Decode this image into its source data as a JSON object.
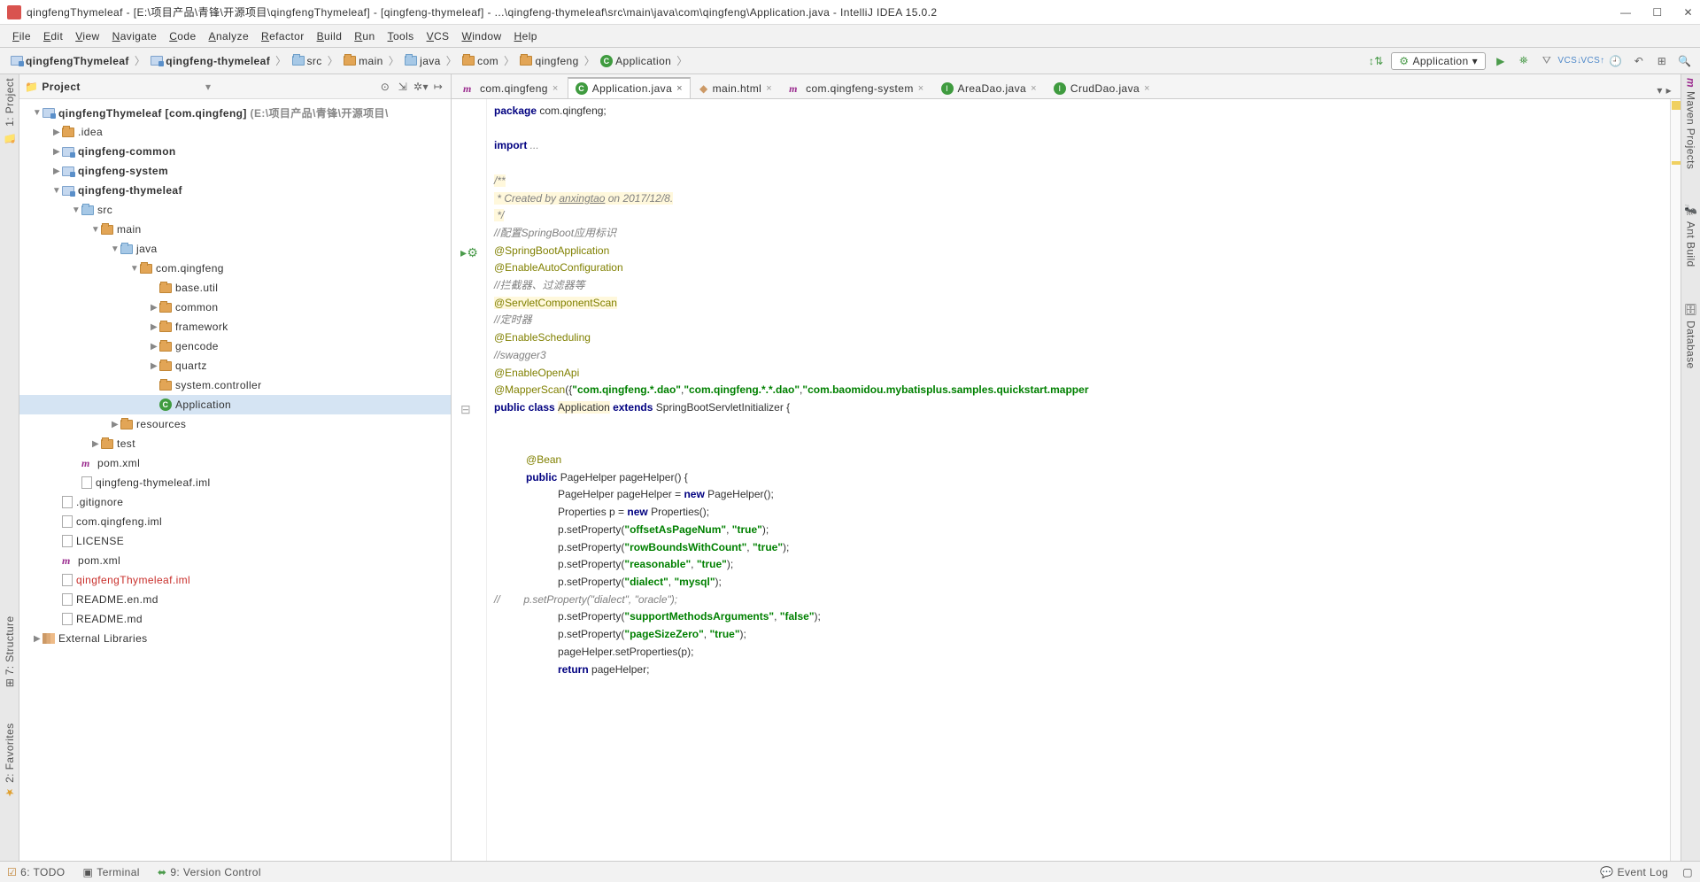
{
  "title": "qingfengThymeleaf - [E:\\项目产品\\青锋\\开源项目\\qingfengThymeleaf] - [qingfeng-thymeleaf] - ...\\qingfeng-thymeleaf\\src\\main\\java\\com\\qingfeng\\Application.java - IntelliJ IDEA 15.0.2",
  "menu": [
    "File",
    "Edit",
    "View",
    "Navigate",
    "Code",
    "Analyze",
    "Refactor",
    "Build",
    "Run",
    "Tools",
    "VCS",
    "Window",
    "Help"
  ],
  "breadcrumbs": [
    {
      "icon": "module",
      "label": "qingfengThymeleaf",
      "bold": true
    },
    {
      "icon": "module",
      "label": "qingfeng-thymeleaf",
      "bold": true
    },
    {
      "icon": "folder-blue",
      "label": "src"
    },
    {
      "icon": "folder",
      "label": "main"
    },
    {
      "icon": "folder-blue",
      "label": "java"
    },
    {
      "icon": "folder",
      "label": "com"
    },
    {
      "icon": "folder",
      "label": "qingfeng"
    },
    {
      "icon": "class",
      "label": "Application"
    }
  ],
  "run_config": "Application",
  "left_tools": [
    "1: Project"
  ],
  "left_tools2": [
    "7: Structure",
    "2: Favorites"
  ],
  "right_tools": [
    "Maven Projects",
    "Ant Build",
    "Database"
  ],
  "project_pane": {
    "title": "Project"
  },
  "tree": [
    {
      "d": 0,
      "a": "▼",
      "i": "module",
      "t": "qingfengThymeleaf",
      "suffix": " [com.qingfeng]",
      "gray": " (E:\\项目产品\\青锋\\开源项目\\",
      "bold": true
    },
    {
      "d": 1,
      "a": "▶",
      "i": "folder",
      "t": ".idea"
    },
    {
      "d": 1,
      "a": "▶",
      "i": "module",
      "t": "qingfeng-common",
      "bold": true
    },
    {
      "d": 1,
      "a": "▶",
      "i": "module",
      "t": "qingfeng-system",
      "bold": true
    },
    {
      "d": 1,
      "a": "▼",
      "i": "module",
      "t": "qingfeng-thymeleaf",
      "bold": true
    },
    {
      "d": 2,
      "a": "▼",
      "i": "folder-blue",
      "t": "src"
    },
    {
      "d": 3,
      "a": "▼",
      "i": "folder",
      "t": "main"
    },
    {
      "d": 4,
      "a": "▼",
      "i": "folder-blue",
      "t": "java"
    },
    {
      "d": 5,
      "a": "▼",
      "i": "folder",
      "t": "com.qingfeng"
    },
    {
      "d": 6,
      "a": "",
      "i": "folder",
      "t": "base.util"
    },
    {
      "d": 6,
      "a": "▶",
      "i": "folder",
      "t": "common"
    },
    {
      "d": 6,
      "a": "▶",
      "i": "folder",
      "t": "framework"
    },
    {
      "d": 6,
      "a": "▶",
      "i": "folder",
      "t": "gencode"
    },
    {
      "d": 6,
      "a": "▶",
      "i": "folder",
      "t": "quartz"
    },
    {
      "d": 6,
      "a": "",
      "i": "folder",
      "t": "system.controller"
    },
    {
      "d": 6,
      "a": "",
      "i": "class-run",
      "t": "Application",
      "sel": true
    },
    {
      "d": 4,
      "a": "▶",
      "i": "folder",
      "t": "resources"
    },
    {
      "d": 3,
      "a": "▶",
      "i": "folder",
      "t": "test"
    },
    {
      "d": 2,
      "a": "",
      "i": "m",
      "t": "pom.xml"
    },
    {
      "d": 2,
      "a": "",
      "i": "file",
      "t": "qingfeng-thymeleaf.iml"
    },
    {
      "d": 1,
      "a": "",
      "i": "file",
      "t": ".gitignore"
    },
    {
      "d": 1,
      "a": "",
      "i": "file",
      "t": "com.qingfeng.iml"
    },
    {
      "d": 1,
      "a": "",
      "i": "file",
      "t": "LICENSE"
    },
    {
      "d": 1,
      "a": "",
      "i": "m",
      "t": "pom.xml"
    },
    {
      "d": 1,
      "a": "",
      "i": "file",
      "t": "qingfengThymeleaf.iml",
      "red": true
    },
    {
      "d": 1,
      "a": "",
      "i": "file",
      "t": "README.en.md"
    },
    {
      "d": 1,
      "a": "",
      "i": "file",
      "t": "README.md"
    },
    {
      "d": 0,
      "a": "▶",
      "i": "lib",
      "t": "External Libraries"
    }
  ],
  "tabs": [
    {
      "icon": "m",
      "label": "com.qingfeng"
    },
    {
      "icon": "class",
      "label": "Application.java",
      "active": true
    },
    {
      "icon": "html",
      "label": "main.html"
    },
    {
      "icon": "m",
      "label": "com.qingfeng-system"
    },
    {
      "icon": "iface",
      "label": "AreaDao.java"
    },
    {
      "icon": "iface",
      "label": "CrudDao.java"
    }
  ],
  "code": {
    "l1": {
      "kw": "package",
      "rest": " com.qingfeng;"
    },
    "l3": {
      "kw": "import",
      "rest": " ..."
    },
    "doc1": "/**",
    "doc2": " * Created by ",
    "doc2u": "anxingtao",
    "doc2b": " on 2017/12/8.",
    "doc3": " */",
    "c1": "//配置SpringBoot应用标识",
    "a1": "@SpringBootApplication",
    "a2": "@EnableAutoConfiguration",
    "c2": "//拦截器、过滤器等",
    "a3": "@ServletComponentScan",
    "c3": "//定时器",
    "a4": "@EnableScheduling",
    "c4": "//swagger3",
    "a5": "@EnableOpenApi",
    "a6a": "@MapperScan",
    "a6b": "({",
    "s1": "\"com.qingfeng.*.dao\"",
    "a6c": ",",
    "s2": "\"com.qingfeng.*.*.dao\"",
    "a6d": ",",
    "s3": "\"com.baomidou.mybatisplus.samples.quickstart.mapper",
    "cl1a": "public class ",
    "cl1b": "Application",
    "cl1c": " extends ",
    "cl1d": "SpringBootServletInitializer {",
    "bean": "@Bean",
    "m1a": "public",
    "m1b": " PageHelper pageHelper() {",
    "b1a": "PageHelper pageHelper = ",
    "b1b": "new",
    "b1c": " PageHelper();",
    "b2a": "Properties p = ",
    "b2b": "new",
    "b2c": " Properties();",
    "b3a": "p.setProperty(",
    "b3s": "\"offsetAsPageNum\"",
    "b3b": ", ",
    "b3s2": "\"true\"",
    "b3c": ");",
    "b4a": "p.setProperty(",
    "b4s": "\"rowBoundsWithCount\"",
    "b4b": ", ",
    "b4s2": "\"true\"",
    "b4c": ");",
    "b5a": "p.setProperty(",
    "b5s": "\"reasonable\"",
    "b5b": ", ",
    "b5s2": "\"true\"",
    "b5c": ");",
    "b6a": "p.setProperty(",
    "b6s": "\"dialect\"",
    "b6b": ", ",
    "b6s2": "\"mysql\"",
    "b6c": ");",
    "b7": "//        p.setProperty(\"dialect\", \"oracle\");",
    "b8a": "p.setProperty(",
    "b8s": "\"supportMethodsArguments\"",
    "b8b": ", ",
    "b8s2": "\"false\"",
    "b8c": ");",
    "b9a": "p.setProperty(",
    "b9s": "\"pageSizeZero\"",
    "b9b": ", ",
    "b9s2": "\"true\"",
    "b9c": ");",
    "b10": "pageHelper.setProperties(p);",
    "b11a": "return ",
    "b11b": "pageHelper;"
  },
  "status": {
    "todo": "6: TODO",
    "term": "Terminal",
    "vcs": "9: Version Control",
    "log": "Event Log"
  }
}
